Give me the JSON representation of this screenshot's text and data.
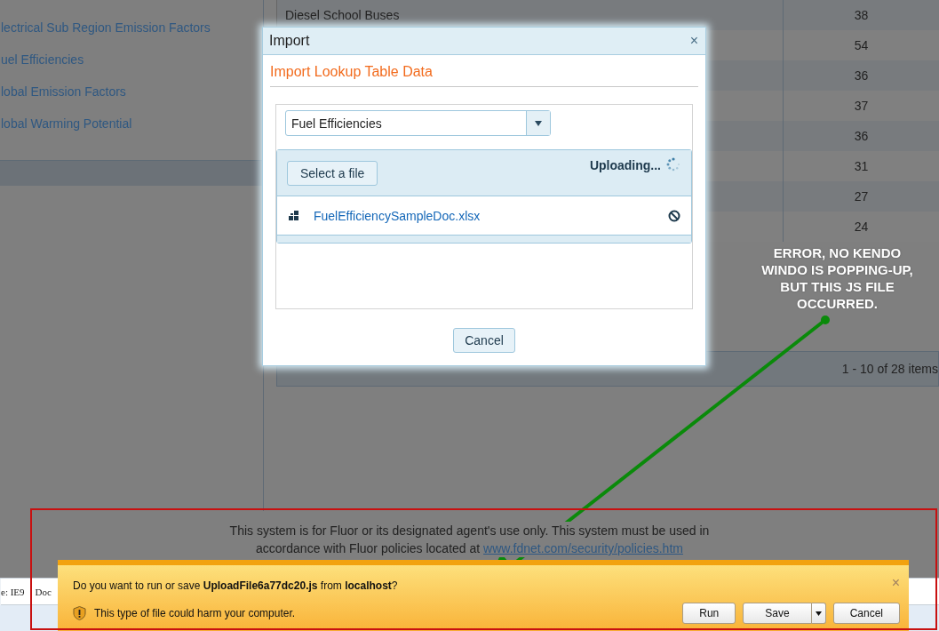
{
  "sidebar": {
    "items": [
      "lectrical Sub Region Emission Factors",
      "uel Efficiencies",
      "lobal Emission Factors",
      "lobal Warming Potential"
    ]
  },
  "grid": {
    "rows": [
      {
        "name": "Diesel School Buses",
        "value": "38"
      },
      {
        "value": "54"
      },
      {
        "value": "36"
      },
      {
        "value": "37"
      },
      {
        "value": "36"
      },
      {
        "value": "31"
      },
      {
        "value": "27"
      },
      {
        "value": "24"
      }
    ]
  },
  "pager": {
    "summary": "1 - 10 of 28 items"
  },
  "modal": {
    "title": "Import",
    "close": "×",
    "heading": "Import Lookup Table Data",
    "dropdown": {
      "value": "Fuel Efficiencies"
    },
    "upload": {
      "button": "Select a file",
      "status": "Uploading...",
      "files": [
        {
          "name": "FuelEfficiencySampleDoc.xlsx"
        }
      ]
    },
    "cancel": "Cancel"
  },
  "footer": {
    "line_1": "This system is for Fluor or its designated agent's use only. This system must be used in",
    "line_2": "accordance with Fluor policies located at",
    "link": "www.fdnet.com/security/policies.htm"
  },
  "devtools": {
    "items": [
      "e: IE9",
      "Doc"
    ]
  },
  "download_bar": {
    "message": "Do you want to run or save **UploadFile6a77dc20.js** from **localhost**?",
    "warning": "This type of file could harm your computer.",
    "buttons": [
      "Run",
      "Save",
      "Cancel"
    ],
    "close": "×"
  },
  "annotation": {
    "text": "ERROR, NO KENDO WINDO IS POPPING-UP, BUT THIS JS FILE OCCURRED."
  }
}
